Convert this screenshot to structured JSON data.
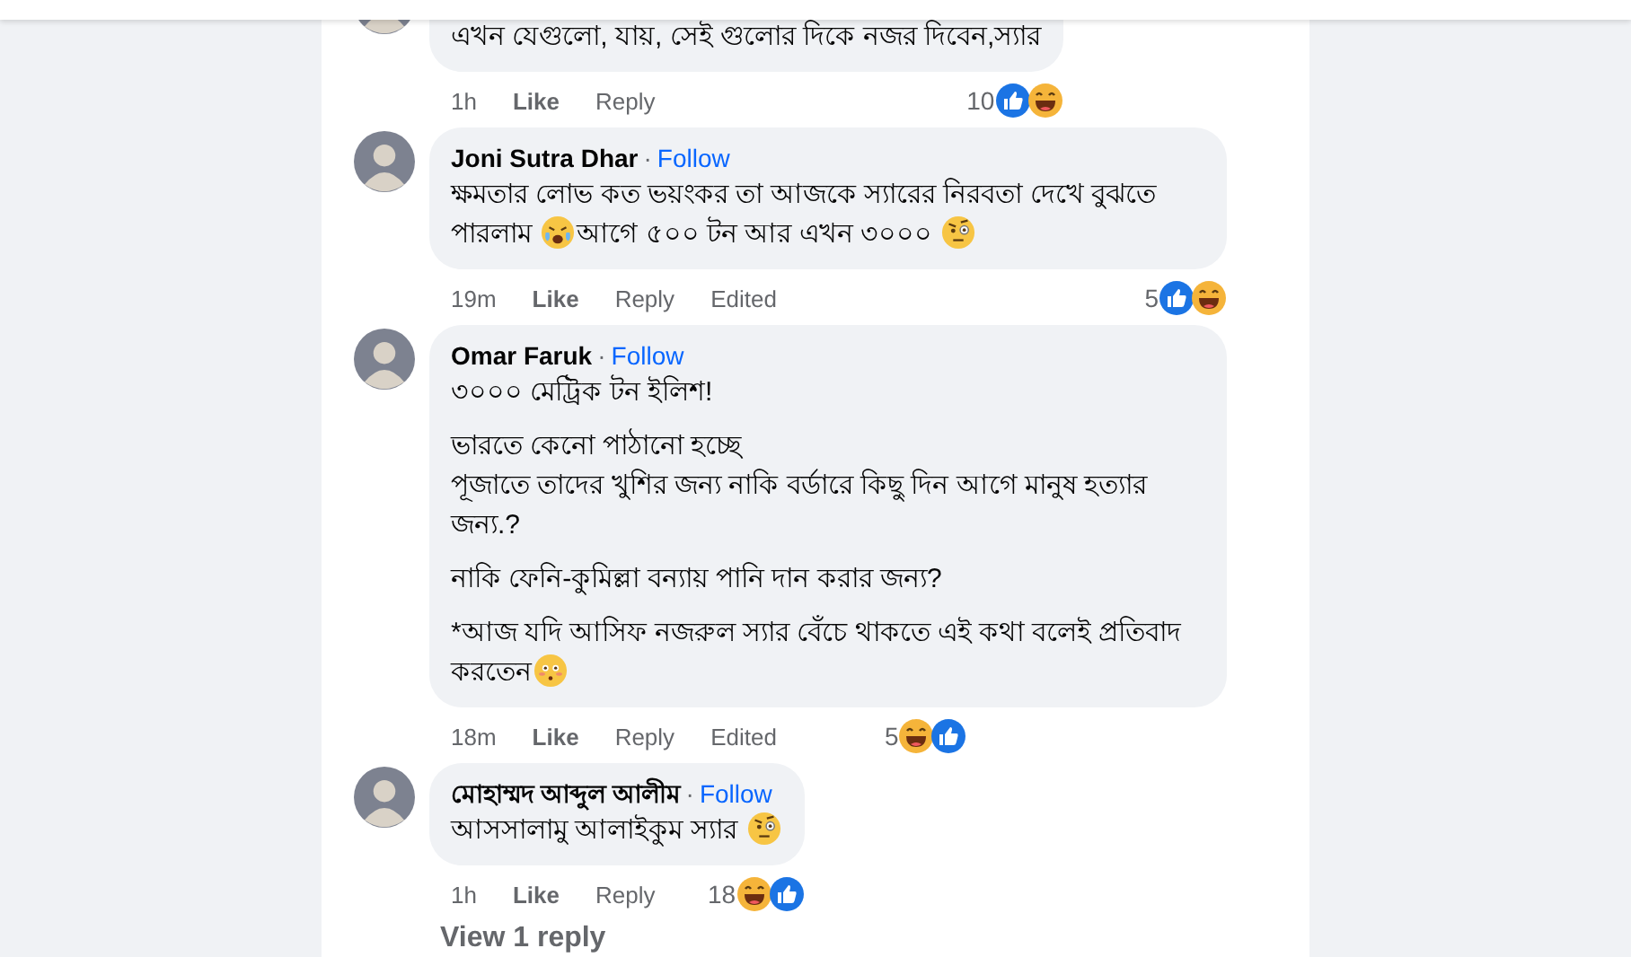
{
  "comments": [
    {
      "paragraphs": [
        [
          {
            "kind": "text",
            "text": "এখন যেগুলো, যায়, সেই গুলোর দিকে নজর দিবেন,স্যার"
          }
        ]
      ],
      "time": "1h",
      "like": "Like",
      "reply": "Reply",
      "reaction_count": "10",
      "reactions": [
        {
          "kind": "like"
        },
        {
          "kind": "haha"
        }
      ],
      "reactions_inline": false
    },
    {
      "author": "Joni Sutra Dhar",
      "separator": "·",
      "follow": "Follow",
      "paragraphs": [
        [
          {
            "kind": "text",
            "text": "ক্ষমতার লোভ কত ভয়ংকর তা আজকে স্যারের নিরবতা দেখে বুঝতে পারলাম "
          },
          {
            "kind": "crying"
          },
          {
            "kind": "text",
            "text": "আগে ৫০০ টন আর এখন ৩০০০ "
          },
          {
            "kind": "skeptical"
          }
        ]
      ],
      "time": "19m",
      "like": "Like",
      "reply": "Reply",
      "edited": "Edited",
      "reaction_count": "5",
      "reactions": [
        {
          "kind": "like"
        },
        {
          "kind": "haha"
        }
      ],
      "reactions_inline": false
    },
    {
      "author": "Omar Faruk",
      "separator": "·",
      "follow": "Follow",
      "paragraphs": [
        [
          {
            "kind": "text",
            "text": "৩০০০ মেট্রিক টন ইলিশ!"
          }
        ],
        [
          {
            "kind": "text",
            "text": "ভারতে কেনো পাঠানো হচ্ছে"
          },
          {
            "kind": "break"
          },
          {
            "kind": "text",
            "text": "পূজাতে তাদের খুশির জন্য নাকি বর্ডারে কিছু দিন আগে মানুষ হত্যার জন্য.?"
          }
        ],
        [
          {
            "kind": "text",
            "text": "নাকি ফেনি-কুমিল্লা বন্যায় পানি দান করার জন্য?"
          }
        ],
        [
          {
            "kind": "text",
            "text": "*আজ যদি আসিফ নজরুল স্যার বেঁচে থাকতে এই কথা বলেই প্রতিবাদ করতেন"
          },
          {
            "kind": "flushed"
          }
        ]
      ],
      "time": "18m",
      "like": "Like",
      "reply": "Reply",
      "edited": "Edited",
      "reaction_count": "5",
      "reactions": [
        {
          "kind": "haha"
        },
        {
          "kind": "like"
        }
      ],
      "reactions_inline": true
    },
    {
      "author": "মোহাম্মদ আব্দুল আলীম",
      "separator": "·",
      "follow": "Follow",
      "paragraphs": [
        [
          {
            "kind": "text",
            "text": "আসসালামু আলাইকুম স্যার "
          },
          {
            "kind": "skeptical"
          }
        ]
      ],
      "time": "1h",
      "like": "Like",
      "reply": "Reply",
      "reaction_count": "18",
      "reactions": [
        {
          "kind": "haha"
        },
        {
          "kind": "like"
        }
      ],
      "reactions_inline": false
    }
  ],
  "view_replies": "View 1 reply"
}
